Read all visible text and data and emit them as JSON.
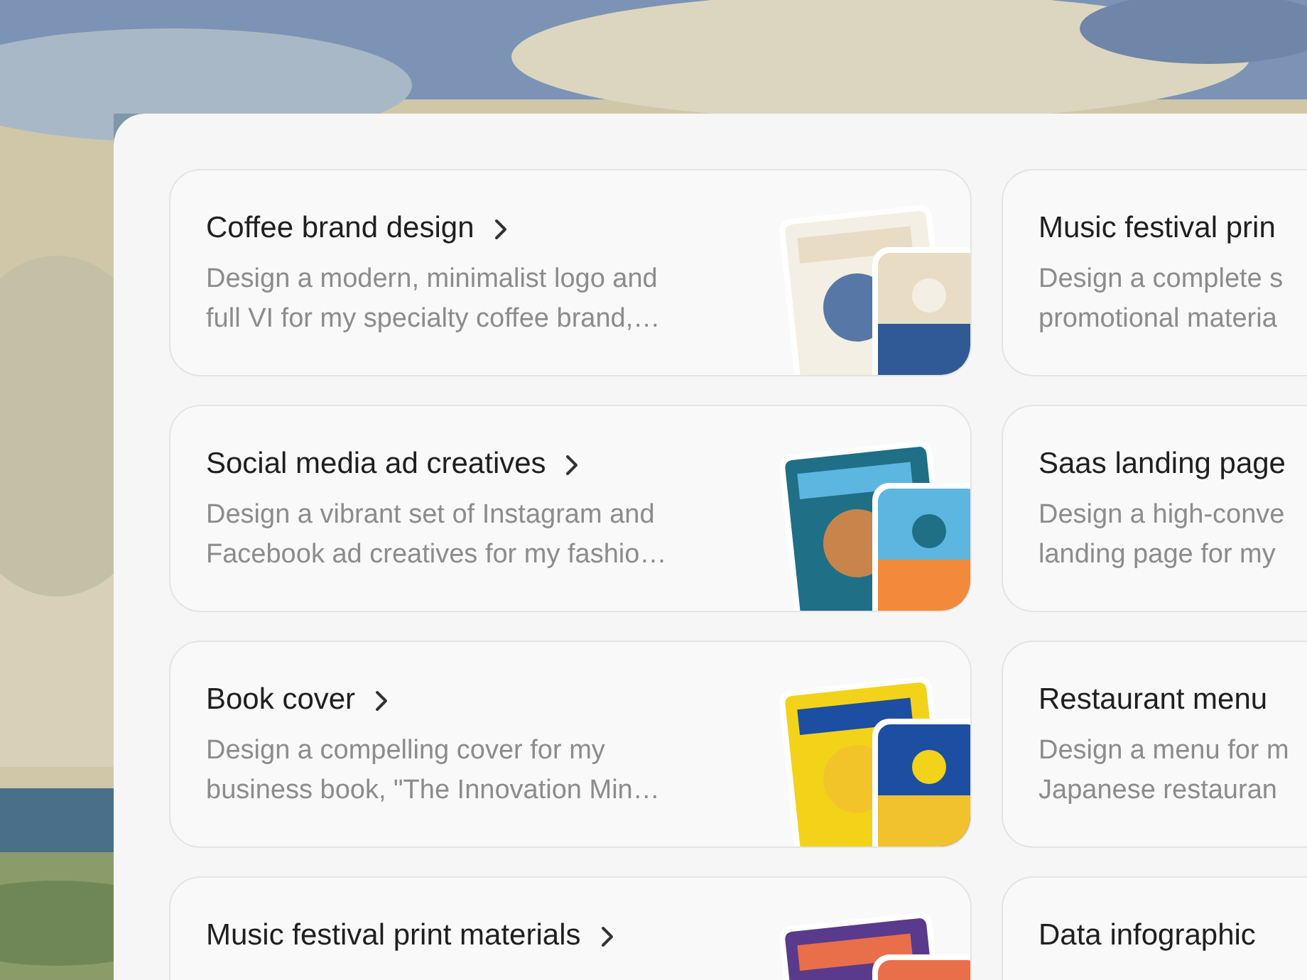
{
  "cards": [
    {
      "title": "Coffee brand design",
      "description_lines": [
        "Design a modern, minimalist logo and",
        "full VI for my specialty coffee brand,…"
      ],
      "kind": "picture"
    },
    {
      "title": "Music festival prin",
      "description_lines": [
        "Design a complete s",
        "promotional materia"
      ]
    },
    {
      "title": "Social media ad creatives",
      "description_lines": [
        "Design a vibrant set of Instagram and",
        "Facebook ad creatives for my fashio…"
      ],
      "kind": "picture"
    },
    {
      "title": "Saas landing page",
      "description_lines": [
        "Design a high-conve",
        "landing page for my"
      ]
    },
    {
      "title": "Book cover",
      "description_lines": [
        "Design a compelling cover for my",
        "business book, \"The Innovation Min…"
      ],
      "kind": "picture"
    },
    {
      "title": "Restaurant menu",
      "description_lines": [
        "Design a menu for m",
        "Japanese restauran"
      ]
    },
    {
      "title": "Music festival print materials",
      "kind": "picture"
    },
    {
      "title": "Data infographic"
    }
  ]
}
